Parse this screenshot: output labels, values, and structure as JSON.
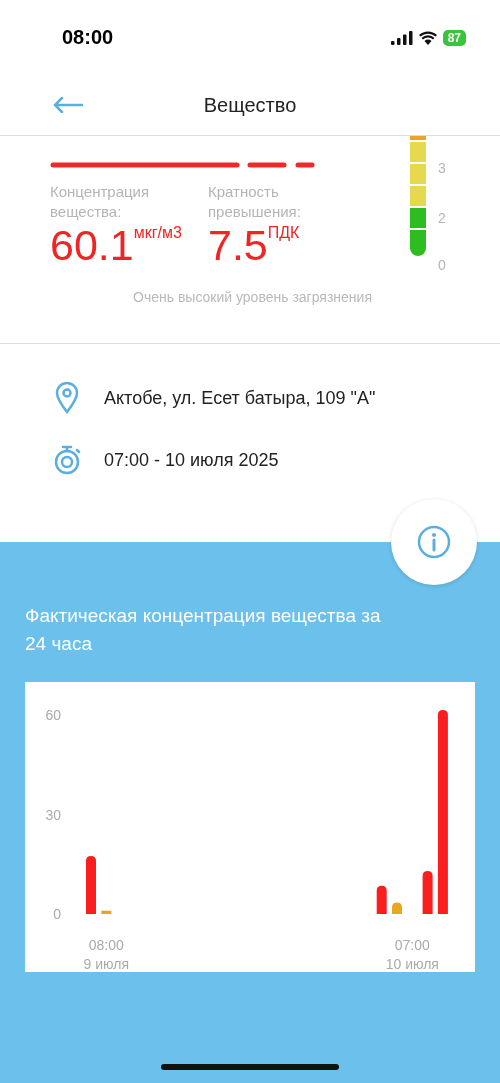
{
  "status_bar": {
    "time": "08:00",
    "battery": "87"
  },
  "header": {
    "title": "Вещество"
  },
  "summary": {
    "concentration_label": "Концентрация вещества:",
    "concentration_value": "60.1",
    "concentration_unit": "мкг/м3",
    "ratio_label": "Кратность превышения:",
    "ratio_value": "7.5",
    "ratio_unit": "ПДК",
    "level_text": "Очень высокий уровень загрязнения",
    "scale": {
      "segments": [
        {
          "color": "#e8a623"
        },
        {
          "color": "#e6d94e"
        },
        {
          "color": "#e6d94e"
        },
        {
          "color": "#e6d94e"
        },
        {
          "color": "#2dbd1f"
        },
        {
          "color": "#2dbd1f"
        }
      ],
      "labels": [
        "3",
        "2",
        "0"
      ]
    }
  },
  "details": [
    {
      "kind": "location",
      "text": "Актобе, ул. Есет батыра, 109 \"А\""
    },
    {
      "kind": "time",
      "text": "07:00 - 10 июля 2025"
    }
  ],
  "history": {
    "title": "Фактическая концентрация вещества за 24 часа",
    "chart_data": {
      "type": "bar",
      "categories": [
        null,
        "08:00\n9 июля",
        null,
        null,
        null,
        null,
        null,
        null,
        null,
        null,
        null,
        null,
        null,
        null,
        null,
        null,
        null,
        null,
        null,
        null,
        null,
        "07:00\n10 июля",
        null,
        null
      ],
      "series": [
        {
          "color": "#fa1e1e",
          "values": [
            17.5,
            null,
            null,
            null,
            null,
            null,
            null,
            null,
            null,
            null,
            null,
            null,
            null,
            null,
            null,
            null,
            null,
            null,
            null,
            8.5,
            null,
            null,
            13,
            61.5
          ]
        },
        {
          "color": "#e6a81e",
          "values": [
            null,
            1,
            null,
            null,
            null,
            null,
            null,
            null,
            null,
            null,
            null,
            null,
            null,
            null,
            null,
            null,
            null,
            null,
            null,
            null,
            3.5,
            null,
            null,
            null
          ]
        }
      ],
      "ylim": [
        0,
        62
      ],
      "yticks": [
        0,
        30,
        60
      ]
    }
  }
}
